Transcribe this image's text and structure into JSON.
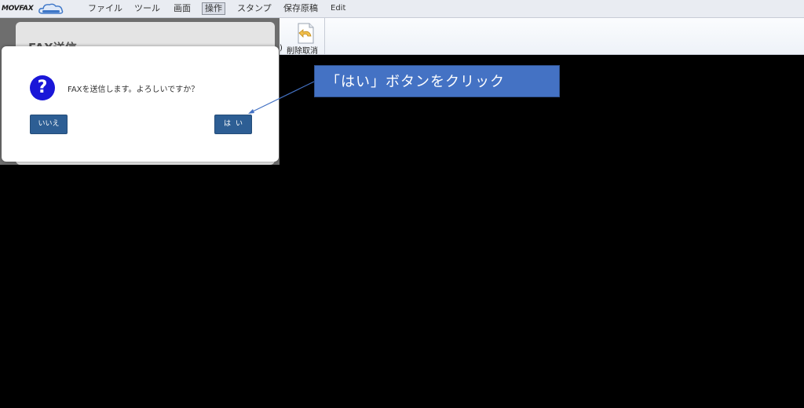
{
  "app": {
    "logo_text": "MOVFAX"
  },
  "menu": {
    "items": [
      {
        "label": "ファイル"
      },
      {
        "label": "ツール"
      },
      {
        "label": "画面"
      },
      {
        "label": "操作"
      },
      {
        "label": "スタンプ"
      },
      {
        "label": "保存原稿"
      },
      {
        "label": "Edit"
      }
    ],
    "active_item": "操作"
  },
  "toolbar": {
    "undo_label": "削除取消",
    "left_fragment": ")"
  },
  "background_panel": {
    "title": "FAX送信"
  },
  "dialog": {
    "icon": "question-icon",
    "message": "FAXを送信します。よろしいですか？",
    "no_label": "いいえ",
    "yes_label": "はい"
  },
  "annotation": {
    "text": "「はい」ボタンをクリック"
  },
  "colors": {
    "button": "#2d5e94",
    "callout": "#4472c4",
    "question_icon": "#1a16d8",
    "background": "#000000"
  }
}
